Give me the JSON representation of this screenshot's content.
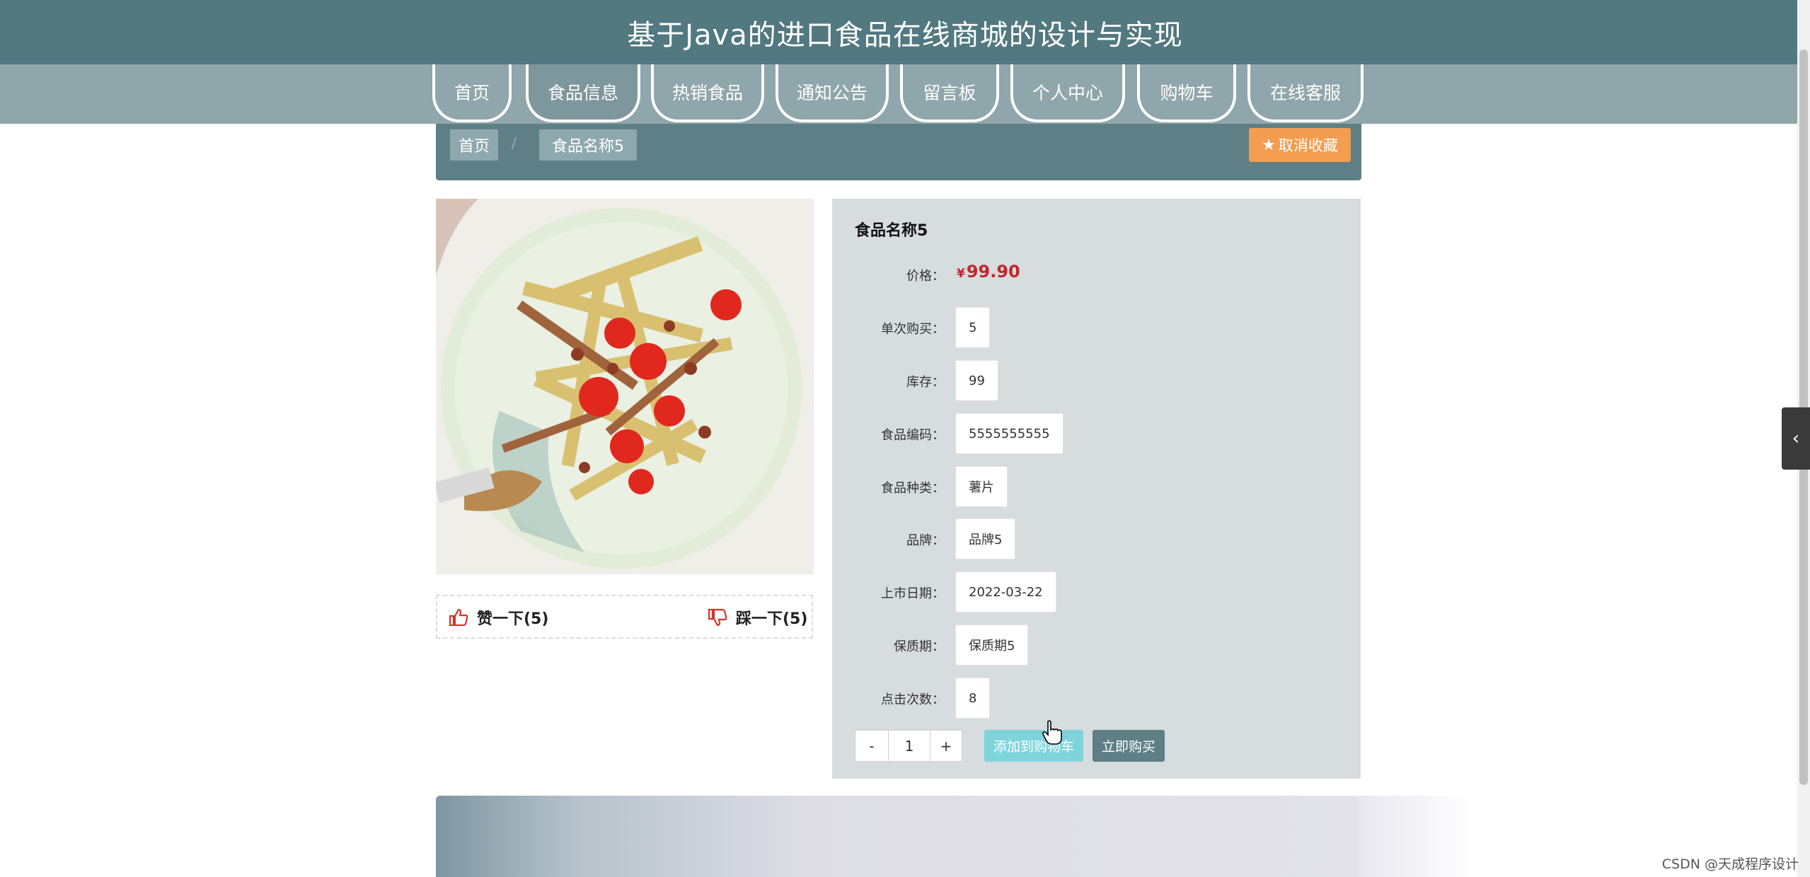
{
  "header": {
    "title": "基于Java的进口食品在线商城的设计与实现"
  },
  "nav": {
    "items": [
      {
        "label": "首页"
      },
      {
        "label": "食品信息"
      },
      {
        "label": "热销食品"
      },
      {
        "label": "通知公告"
      },
      {
        "label": "留言板"
      },
      {
        "label": "个人中心"
      },
      {
        "label": "购物车"
      },
      {
        "label": "在线客服"
      }
    ],
    "active": "食品信息"
  },
  "breadcrumb": {
    "home": "首页",
    "separator": "/",
    "current": "食品名称5"
  },
  "actions": {
    "unfavorite": "取消收藏"
  },
  "votes": {
    "like": "赞一下(5)",
    "dislike": "踩一下(5)"
  },
  "product": {
    "name": "食品名称5",
    "price_label": "价格：",
    "currency": "¥",
    "price": "99.90",
    "fields": [
      {
        "label": "单次购买：",
        "value": "5"
      },
      {
        "label": "库存：",
        "value": "99"
      },
      {
        "label": "食品编码：",
        "value": "5555555555"
      },
      {
        "label": "食品种类：",
        "value": "薯片"
      },
      {
        "label": "品牌：",
        "value": "品牌5"
      },
      {
        "label": "上市日期：",
        "value": "2022-03-22"
      },
      {
        "label": "保质期：",
        "value": "保质期5"
      },
      {
        "label": "点击次数：",
        "value": "8"
      }
    ]
  },
  "purchase": {
    "minus": "-",
    "quantity": "1",
    "plus": "+",
    "add_to_cart": "添加到购物车",
    "buy_now": "立即购买"
  },
  "side_tab": {
    "icon": "‹"
  },
  "watermark": "CSDN @天成程序设计",
  "colors": {
    "header": "#527880",
    "nav": "#8fa6ab",
    "accent": "#5e7f86",
    "fav": "#f29d50",
    "price": "#c1272d",
    "cart": "#7fd4dc"
  }
}
